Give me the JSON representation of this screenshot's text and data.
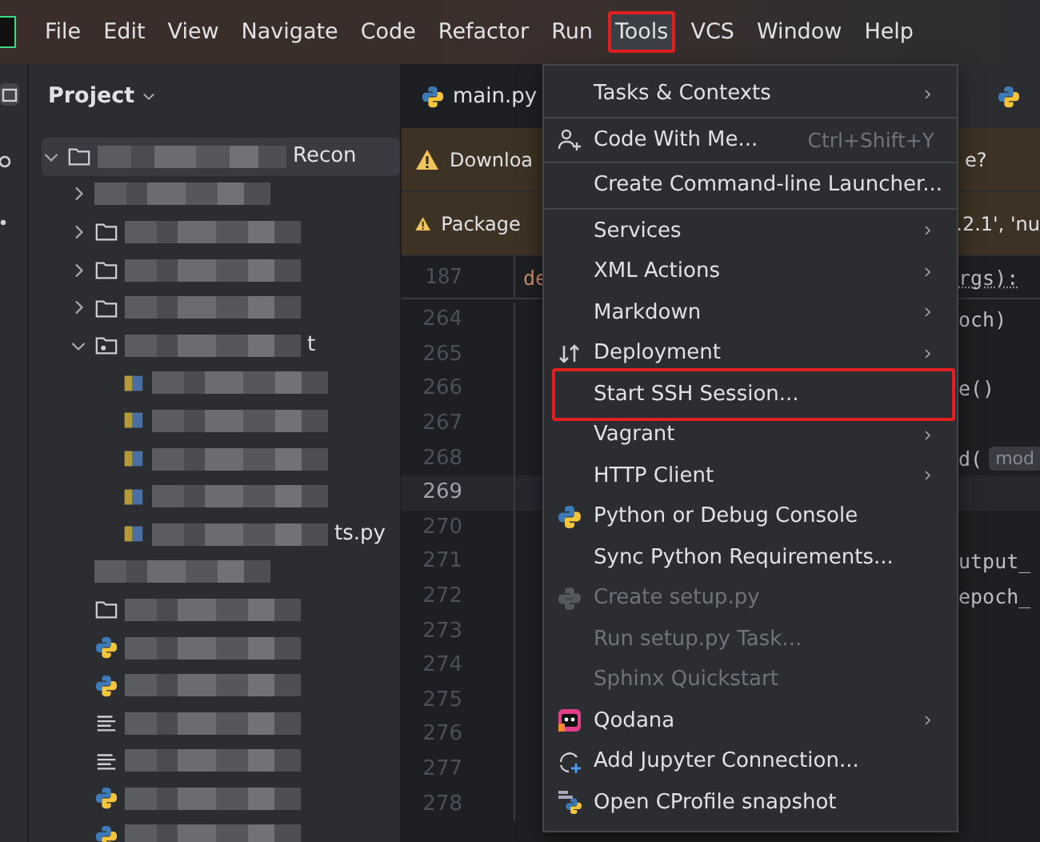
{
  "menubar": {
    "items": [
      {
        "label": "File",
        "highlighted": false
      },
      {
        "label": "Edit",
        "highlighted": false
      },
      {
        "label": "View",
        "highlighted": false
      },
      {
        "label": "Navigate",
        "highlighted": false
      },
      {
        "label": "Code",
        "highlighted": false
      },
      {
        "label": "Refactor",
        "highlighted": false
      },
      {
        "label": "Run",
        "highlighted": false
      },
      {
        "label": "Tools",
        "highlighted": true
      },
      {
        "label": "VCS",
        "highlighted": false
      },
      {
        "label": "Window",
        "highlighted": false
      },
      {
        "label": "Help",
        "highlighted": false
      }
    ]
  },
  "project_panel": {
    "title": "Project",
    "tree": [
      {
        "kind": "folder",
        "label": "Recon",
        "redacted": true,
        "selected": true,
        "expanded": true,
        "children": [
          {
            "kind": "plain",
            "redacted": true,
            "selected": false,
            "expanded": false
          },
          {
            "kind": "folder",
            "redacted": true,
            "selected": false,
            "expanded": false
          },
          {
            "kind": "folder",
            "redacted": true,
            "selected": false,
            "expanded": false
          },
          {
            "kind": "folder",
            "redacted": true,
            "selected": false,
            "expanded": false
          },
          {
            "kind": "package",
            "label": "t",
            "redacted": true,
            "selected": false,
            "expanded": true,
            "children": [
              {
                "kind": "file",
                "redacted": true,
                "selected": false
              },
              {
                "kind": "file",
                "redacted": true,
                "selected": false
              },
              {
                "kind": "file",
                "redacted": true,
                "selected": false
              },
              {
                "kind": "file",
                "redacted": true,
                "selected": false
              },
              {
                "kind": "file",
                "label": "ts.py",
                "redacted": true,
                "selected": false
              }
            ]
          },
          {
            "kind": "plain",
            "redacted": true,
            "selected": false
          },
          {
            "kind": "folder",
            "redacted": true,
            "selected": false
          },
          {
            "kind": "python",
            "redacted": true,
            "selected": false
          },
          {
            "kind": "python",
            "redacted": true,
            "selected": false
          },
          {
            "kind": "text",
            "redacted": true,
            "selected": false
          },
          {
            "kind": "text",
            "redacted": true,
            "selected": false
          },
          {
            "kind": "python",
            "redacted": true,
            "selected": false
          },
          {
            "kind": "python",
            "redacted": true,
            "selected": false
          }
        ]
      }
    ]
  },
  "editor": {
    "tabs": [
      {
        "label": "main.py",
        "selected": true
      },
      {
        "selected": false
      }
    ],
    "notifications": [
      {
        "message_start": "Downloa",
        "message_end": "e?"
      },
      {
        "message_start": "Package",
        "message_end": ".2.1', 'nu"
      }
    ],
    "sticky_line": {
      "number": "187",
      "code_start": "de",
      "code_end": "rgs):"
    },
    "lines": [
      {
        "number": "264",
        "code_end": "och)",
        "current": false
      },
      {
        "number": "265",
        "current": false
      },
      {
        "number": "266",
        "code_end": "e()",
        "current": false
      },
      {
        "number": "267",
        "current": false
      },
      {
        "number": "268",
        "code_end": "d(",
        "hint": "mod",
        "current": false
      },
      {
        "number": "269",
        "current": true
      },
      {
        "number": "270",
        "current": false
      },
      {
        "number": "271",
        "code_end": "utput_",
        "current": false
      },
      {
        "number": "272",
        "code_end": "epoch_",
        "current": false
      },
      {
        "number": "273",
        "current": false
      },
      {
        "number": "274",
        "current": false
      },
      {
        "number": "275",
        "current": false
      },
      {
        "number": "276",
        "current": false
      },
      {
        "number": "277",
        "current": false
      },
      {
        "number": "278",
        "current": false
      }
    ]
  },
  "tools_menu": {
    "items": [
      {
        "kind": "plain",
        "label": "Tasks & Contexts",
        "submenu": true,
        "disabled": false,
        "separator_after": true,
        "highlighted": false
      },
      {
        "kind": "person",
        "label": "Code With Me...",
        "shortcut": "Ctrl+Shift+Y",
        "submenu": false,
        "disabled": false,
        "separator_after": true,
        "highlighted": false
      },
      {
        "kind": "plain",
        "label": "Create Command-line Launcher...",
        "submenu": false,
        "disabled": false,
        "separator_after": true,
        "highlighted": false
      },
      {
        "kind": "plain",
        "label": "Services",
        "submenu": true,
        "disabled": false,
        "separator_after": false,
        "highlighted": false
      },
      {
        "kind": "plain",
        "label": "XML Actions",
        "submenu": true,
        "disabled": false,
        "separator_after": false,
        "highlighted": false
      },
      {
        "kind": "plain",
        "label": "Markdown",
        "submenu": true,
        "disabled": false,
        "separator_after": false,
        "highlighted": false
      },
      {
        "kind": "deploy",
        "label": "Deployment",
        "submenu": true,
        "disabled": false,
        "separator_after": false,
        "highlighted": false
      },
      {
        "kind": "plain",
        "label": "Start SSH Session...",
        "submenu": false,
        "disabled": false,
        "separator_after": false,
        "highlighted": true
      },
      {
        "kind": "plain",
        "label": "Vagrant",
        "submenu": true,
        "disabled": false,
        "separator_after": false,
        "highlighted": false
      },
      {
        "kind": "plain",
        "label": "HTTP Client",
        "submenu": true,
        "disabled": false,
        "separator_after": false,
        "highlighted": false
      },
      {
        "kind": "python",
        "label": "Python or Debug Console",
        "submenu": false,
        "disabled": false,
        "separator_after": false,
        "highlighted": false
      },
      {
        "kind": "plain",
        "label": "Sync Python Requirements...",
        "submenu": false,
        "disabled": false,
        "separator_after": false,
        "highlighted": false
      },
      {
        "kind": "python",
        "label": "Create setup.py",
        "submenu": false,
        "disabled": true,
        "separator_after": false,
        "highlighted": false
      },
      {
        "kind": "plain",
        "label": "Run setup.py Task...",
        "submenu": false,
        "disabled": true,
        "separator_after": false,
        "highlighted": false
      },
      {
        "kind": "plain",
        "label": "Sphinx Quickstart",
        "submenu": false,
        "disabled": true,
        "separator_after": false,
        "highlighted": false
      },
      {
        "kind": "qodana",
        "label": "Qodana",
        "submenu": true,
        "disabled": false,
        "separator_after": false,
        "highlighted": false
      },
      {
        "kind": "jupyter",
        "label": "Add Jupyter Connection...",
        "submenu": false,
        "disabled": false,
        "separator_after": false,
        "highlighted": false
      },
      {
        "kind": "profile",
        "label": "Open CProfile snapshot",
        "submenu": false,
        "disabled": false,
        "separator_after": false,
        "highlighted": false
      }
    ]
  }
}
